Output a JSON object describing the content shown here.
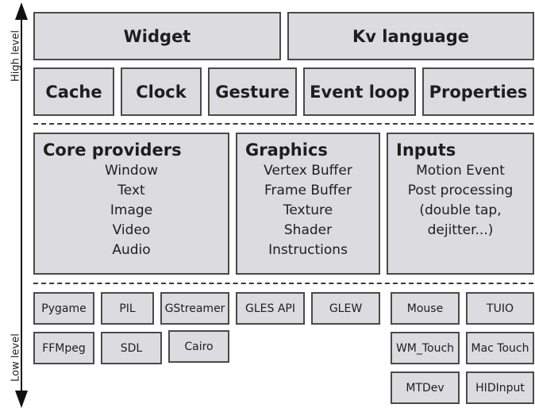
{
  "axis": {
    "high_label": "High level",
    "low_label": "Low level"
  },
  "top_row": [
    "Widget",
    "Kv language"
  ],
  "second_row": [
    "Cache",
    "Clock",
    "Gesture",
    "Event loop",
    "Properties"
  ],
  "panels": [
    {
      "title": "Core providers",
      "items": [
        "Window",
        "Text",
        "Image",
        "Video",
        "Audio"
      ]
    },
    {
      "title": "Graphics",
      "items": [
        "Vertex Buffer",
        "Frame Buffer",
        "Texture",
        "Shader",
        "Instructions"
      ]
    },
    {
      "title": "Inputs",
      "items": [
        "Motion Event",
        "Post processing",
        "(double tap,",
        "dejitter...)"
      ]
    }
  ],
  "low_level": {
    "core": [
      "Pygame",
      "PIL",
      "GStreamer",
      "FFMpeg",
      "SDL",
      "Cairo"
    ],
    "graphics": [
      "GLES API",
      "GLEW"
    ],
    "inputs": [
      "Mouse",
      "TUIO",
      "WM_Touch",
      "Mac Touch",
      "MTDev",
      "HIDInput"
    ]
  },
  "colors": {
    "box_fill": "#dcdce0",
    "box_border": "#4a4a4a",
    "text": "#1e1e1e"
  }
}
